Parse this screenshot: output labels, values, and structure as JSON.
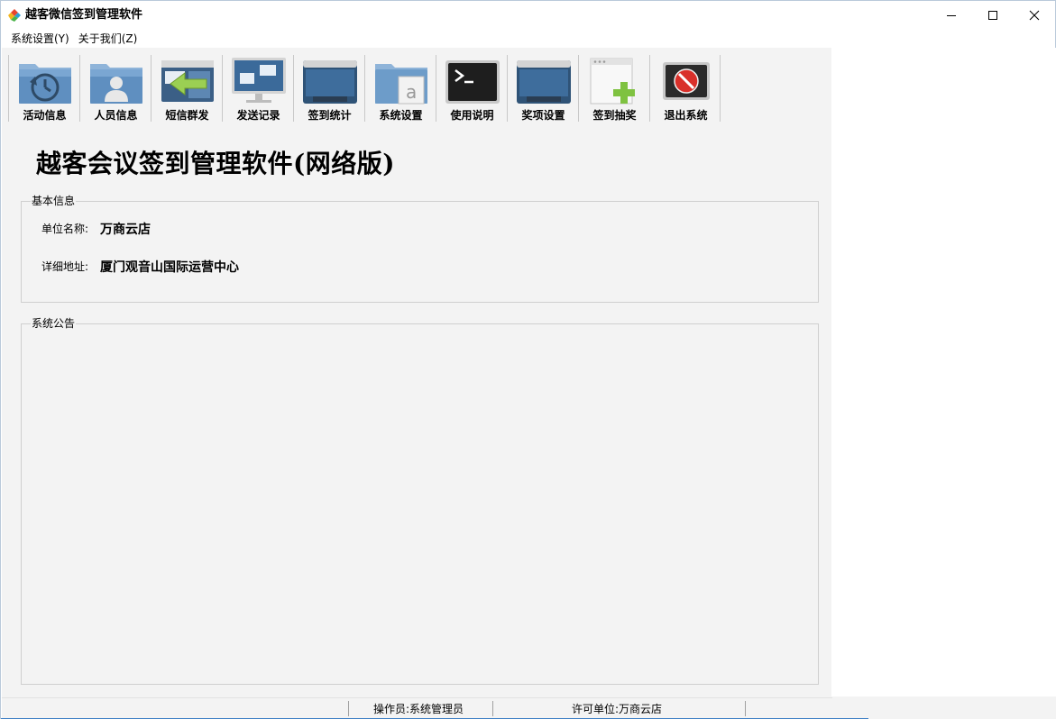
{
  "window": {
    "title": "越客微信签到管理软件"
  },
  "menu": [
    {
      "label": "系统设置(Y)"
    },
    {
      "label": "关于我们(Z)"
    }
  ],
  "toolbar": [
    {
      "label": "活动信息",
      "icon": "history-folder-icon"
    },
    {
      "label": "人员信息",
      "icon": "user-folder-icon"
    },
    {
      "label": "短信群发",
      "icon": "sms-arrow-icon"
    },
    {
      "label": "发送记录",
      "icon": "monitor-windows-icon"
    },
    {
      "label": "签到统计",
      "icon": "dark-window-icon"
    },
    {
      "label": "系统设置",
      "icon": "document-folder-icon"
    },
    {
      "label": "使用说明",
      "icon": "terminal-icon"
    },
    {
      "label": "奖项设置",
      "icon": "dark-window-icon"
    },
    {
      "label": "签到抽奖",
      "icon": "add-window-icon"
    },
    {
      "label": "退出系统",
      "icon": "stop-icon"
    }
  ],
  "main": {
    "headline": "越客会议签到管理软件(网络版)",
    "basic_info": {
      "title": "基本信息",
      "org_label": "单位名称:",
      "org_value": "万商云店",
      "address_label": "详细地址:",
      "address_value": "厦门观音山国际运营中心"
    },
    "notice": {
      "title": "系统公告"
    }
  },
  "status": {
    "operator": "操作员:系统管理员",
    "license": "许可单位:万商云店"
  },
  "colors": {
    "accent_blue": "#3d7fc4",
    "client_bg": "#f3f3f3",
    "folder_blue": "#6d9cc9",
    "stop_red": "#d9302a",
    "plus_green": "#7fc241"
  }
}
